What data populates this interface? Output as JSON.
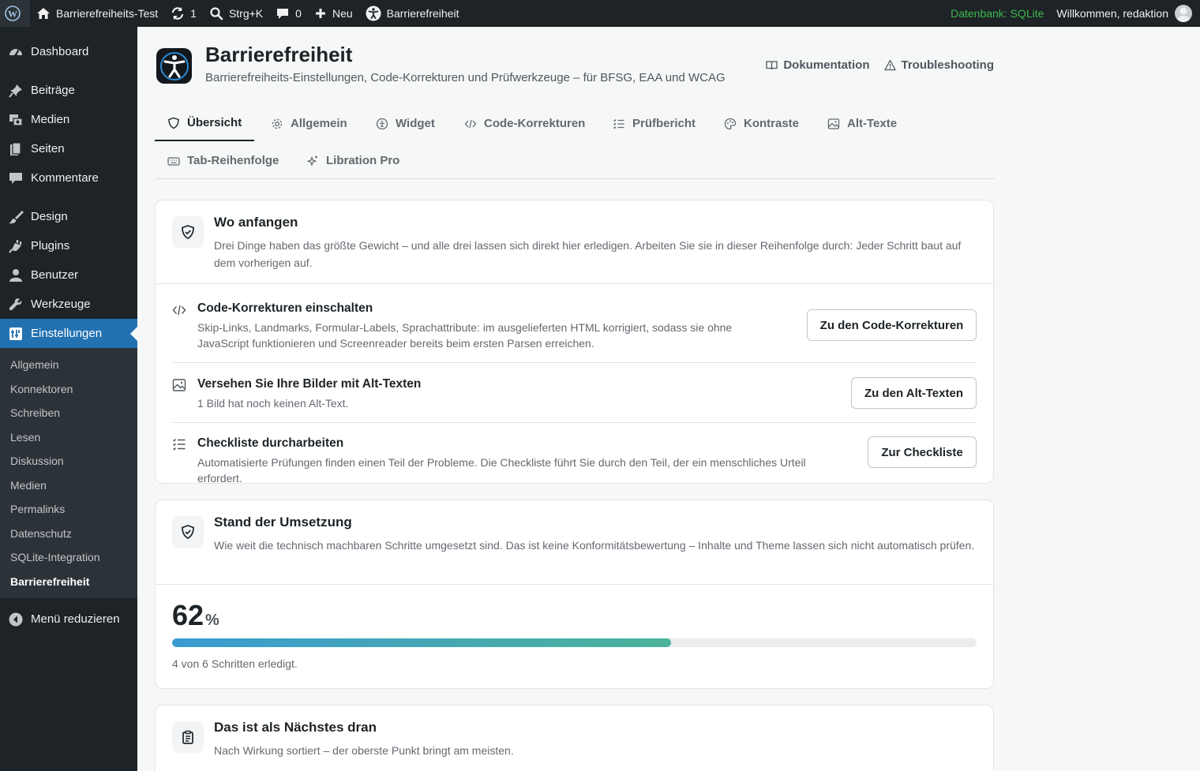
{
  "adminbar": {
    "site_name": "Barrierefreiheits-Test",
    "updates_count": "1",
    "search_shortcut": "Strg+K",
    "comments_count": "0",
    "new_label": "Neu",
    "plugin_label": "Barrierefreiheit",
    "database_label": "Datenbank: SQLite",
    "welcome_text": "Willkommen, redaktion"
  },
  "sidebar": {
    "items": [
      {
        "label": "Dashboard",
        "icon": "dashboard-icon"
      },
      {
        "label": "Beiträge",
        "icon": "pin-icon"
      },
      {
        "label": "Medien",
        "icon": "media-icon"
      },
      {
        "label": "Seiten",
        "icon": "pages-icon"
      },
      {
        "label": "Kommentare",
        "icon": "comment-icon"
      },
      {
        "label": "Design",
        "icon": "brush-icon"
      },
      {
        "label": "Plugins",
        "icon": "plugin-icon"
      },
      {
        "label": "Benutzer",
        "icon": "user-icon"
      },
      {
        "label": "Werkzeuge",
        "icon": "wrench-icon"
      },
      {
        "label": "Einstellungen",
        "icon": "settings-icon"
      }
    ],
    "submenu": [
      "Allgemein",
      "Konnektoren",
      "Schreiben",
      "Lesen",
      "Diskussion",
      "Medien",
      "Permalinks",
      "Datenschutz",
      "SQLite-Integration",
      "Barrierefreiheit"
    ],
    "collapse_label": "Menü reduzieren",
    "accent": "#2271b1"
  },
  "header": {
    "title": "Barrierefreiheit",
    "subtitle": "Barrierefreiheits-Einstellungen, Code-Korrekturen und Prüfwerkzeuge – für BFSG, EAA und WCAG",
    "links": [
      "Dokumentation",
      "Troubleshooting"
    ]
  },
  "tabs": [
    "Übersicht",
    "Allgemein",
    "Widget",
    "Code-Korrekturen",
    "Prüfbericht",
    "Kontraste",
    "Alt-Texte",
    "Tab-Reihenfolge",
    "Libration Pro"
  ],
  "start_card": {
    "title": "Wo anfangen",
    "description": "Drei Dinge haben das größte Gewicht – und alle drei lassen sich direkt hier erledigen. Arbeiten Sie sie in dieser Reihenfolge durch: Jeder Schritt baut auf dem vorherigen auf.",
    "steps": [
      {
        "title": "Code-Korrekturen einschalten",
        "text": "Skip-Links, Landmarks, Formular-Labels, Sprachattribute: im ausgelieferten HTML korrigiert, sodass sie ohne JavaScript funktionieren und Screenreader bereits beim ersten Parsen erreichen.",
        "button": "Zu den Code-Korrekturen",
        "icon": "code-icon"
      },
      {
        "title": "Versehen Sie Ihre Bilder mit Alt-Texten",
        "text": "1 Bild hat noch keinen Alt-Text.",
        "button": "Zu den Alt-Texten",
        "icon": "image-icon"
      },
      {
        "title": "Checkliste durcharbeiten",
        "text": "Automatisierte Prüfungen finden einen Teil der Probleme. Die Checkliste führt Sie durch den Teil, der ein menschliches Urteil erfordert.",
        "button": "Zur Checkliste",
        "icon": "checklist-icon"
      }
    ]
  },
  "progress_card": {
    "title": "Stand der Umsetzung",
    "description": "Wie weit die technisch machbaren Schritte umgesetzt sind. Das ist keine Konformitätsbewertung – Inhalte und Theme lassen sich nicht automatisch prüfen.",
    "percent": "62",
    "percent_unit": "%",
    "fraction": 0.62,
    "caption": "4 von 6 Schritten erledigt."
  },
  "next_card": {
    "title": "Das ist als Nächstes dran",
    "description": "Nach Wirkung sortiert – der oberste Punkt bringt am meisten."
  }
}
